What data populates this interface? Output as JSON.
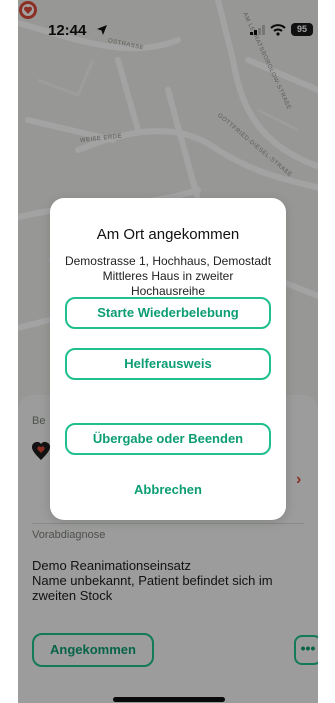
{
  "status_bar": {
    "time": "12:44",
    "battery": "95",
    "icons": [
      "location-arrow-icon",
      "signal-icon",
      "wifi-icon",
      "battery-icon"
    ]
  },
  "map": {
    "street_labels": [
      "OSTRASSE",
      "AM LEBRATSBOROLOW-STRAßE",
      "WEIßE ERDE",
      "GOTTFRIED-DIESEL-STRAßE"
    ]
  },
  "sheet": {
    "section_label": "Be",
    "diagnosis_label": "Vorabdiagnose",
    "diagnosis_lines": [
      "Demo Reanimationseinsatz",
      "Name unbekannt, Patient befindet sich im",
      "zweiten Stock"
    ],
    "arrived_button": "Angekommen",
    "more_button": "•••"
  },
  "modal": {
    "title": "Am Ort angekommen",
    "address_lines": [
      "Demostrasse 1, Hochhaus, Demostadt",
      "Mittleres Haus in zweiter",
      "Hochausreihe"
    ],
    "buttons": {
      "start_resuscitation": "Starte Wiederbelebung",
      "helper_id": "Helferausweis",
      "handover_or_end": "Übergabe oder Beenden"
    },
    "cancel": "Abbrechen"
  },
  "colors": {
    "accent": "#1fbf8e",
    "accent_text": "#0c9d73",
    "alert_red": "#d94a3b",
    "location_blue": "#2b6fd6"
  }
}
